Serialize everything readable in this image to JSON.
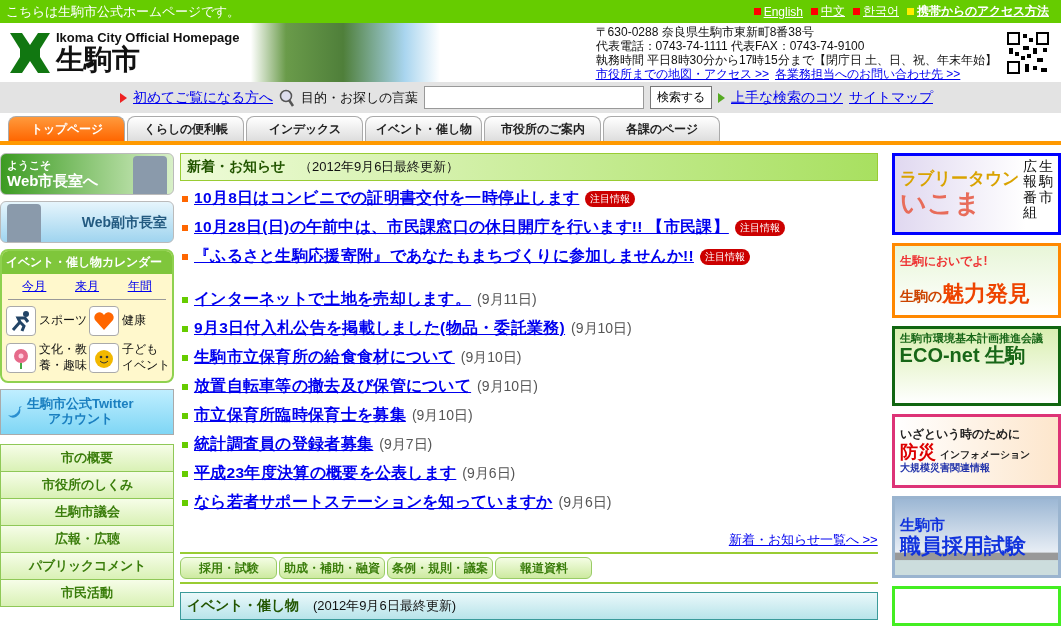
{
  "top_bar": {
    "notice": "こちらは生駒市公式ホームページです。",
    "links": [
      {
        "label": "English",
        "bold": false
      },
      {
        "label": "中文",
        "bold": false
      },
      {
        "label": "한국어",
        "bold": false
      },
      {
        "label": "携帯からのアクセス方法",
        "bold": true
      }
    ]
  },
  "header": {
    "logo_en": "Ikoma City Official Homepage",
    "logo_ja": "生駒市",
    "address_lines": [
      "〒630-0288 奈良県生駒市東新町8番38号",
      "代表電話：0743-74-1111 代表FAX：0743-74-9100",
      "執務時間 平日8時30分から17時15分まで【閉庁日 土、日、祝、年末年始】"
    ],
    "links": [
      "市役所までの地図・アクセス >>",
      "各業務担当へのお問い合わせ先 >>"
    ]
  },
  "search": {
    "first_visit": "初めてご覧になる方へ",
    "label": "目的・お探しの言葉",
    "button": "検索する",
    "links": [
      "上手な検索のコツ",
      "サイトマップ"
    ]
  },
  "tabs": [
    {
      "label": "トップページ",
      "selected": true
    },
    {
      "label": "くらしの便利帳",
      "selected": false
    },
    {
      "label": "インデックス",
      "selected": false
    },
    {
      "label": "イベント・催し物",
      "selected": false
    },
    {
      "label": "市役所のご案内",
      "selected": false
    },
    {
      "label": "各課のページ",
      "selected": false
    }
  ],
  "sidebar": {
    "mayor": {
      "greeting": "ようこそ",
      "title": "Web市長室へ"
    },
    "vice_mayor": "Web副市長室",
    "calendar": {
      "title": "イベント・催し物カレンダー",
      "periods": [
        "今月",
        "来月",
        "年間"
      ],
      "categories": [
        {
          "kind": "sports",
          "lines": [
            "スポーツ"
          ]
        },
        {
          "kind": "health",
          "lines": [
            "健康"
          ]
        },
        {
          "kind": "culture",
          "lines": [
            "文化・教",
            "養・趣味"
          ]
        },
        {
          "kind": "kids",
          "lines": [
            "子ども",
            "イベント"
          ]
        }
      ]
    },
    "twitter": [
      "生駒市公式Twitter",
      "アカウント"
    ],
    "menu": [
      "市の概要",
      "市役所のしくみ",
      "生駒市議会",
      "広報・広聴",
      "パブリックコメント",
      "市民活動"
    ]
  },
  "news": {
    "title": "新着・お知らせ",
    "updated": "（2012年9月6日最終更新）",
    "items": [
      {
        "kind": "notice",
        "text": "10月8日はコンビニでの証明書交付を一時停止します",
        "badge": "注目情報"
      },
      {
        "kind": "notice",
        "text": "10月28日(日)の午前中は、市民課窓口の休日開庁を行います!! 【市民課】",
        "badge": "注目情報"
      },
      {
        "kind": "notice",
        "text": "『ふるさと生駒応援寄附』であなたもまちづくりに参加しませんか!!",
        "badge": "注目情報"
      },
      {
        "kind": "regular",
        "text": "インターネットで土地を売却します。",
        "date": "(9月11日)"
      },
      {
        "kind": "regular",
        "text": "9月3日付入札公告を掲載しました(物品・委託業務)",
        "date": "(9月10日)"
      },
      {
        "kind": "regular",
        "text": "生駒市立保育所の給食食材について",
        "date": "(9月10日)"
      },
      {
        "kind": "regular",
        "text": "放置自転車等の撤去及び保管について",
        "date": "(9月10日)"
      },
      {
        "kind": "regular",
        "text": "市立保育所臨時保育士を募集",
        "date": "(9月10日)"
      },
      {
        "kind": "regular",
        "text": "統計調査員の登録者募集",
        "date": "(9月7日)"
      },
      {
        "kind": "regular",
        "text": "平成23年度決算の概要を公表します",
        "date": "(9月6日)"
      },
      {
        "kind": "regular",
        "text": "なら若者サポートステーションを知っていますか",
        "date": "(9月6日)"
      }
    ],
    "more": "新着・お知らせ一覧へ >>"
  },
  "category_buttons": [
    "採用・試験",
    "助成・補助・融資",
    "条例・規則・議案",
    "報道資料"
  ],
  "events": {
    "title": "イベント・催し物",
    "updated": "(2012年9月6日最終更新)"
  },
  "banners": [
    {
      "kind": "tv",
      "lines": [
        "ラブリータウン",
        "いこま",
        "広報番組",
        "生駒市"
      ]
    },
    {
      "kind": "charm",
      "lines": [
        "生駒においでよ!",
        "生駒の",
        "魅力発見"
      ]
    },
    {
      "kind": "eco",
      "lines": [
        "生駒市環境基本計画推進会議",
        "ECO-net 生駒"
      ]
    },
    {
      "kind": "disaster",
      "lines": [
        "いざという時のために",
        "防災",
        "インフォメーション",
        "大規模災害関連情報"
      ]
    },
    {
      "kind": "recruit",
      "lines": [
        "生駒市",
        "職員採用試験"
      ]
    },
    {
      "kind": "partial"
    }
  ]
}
